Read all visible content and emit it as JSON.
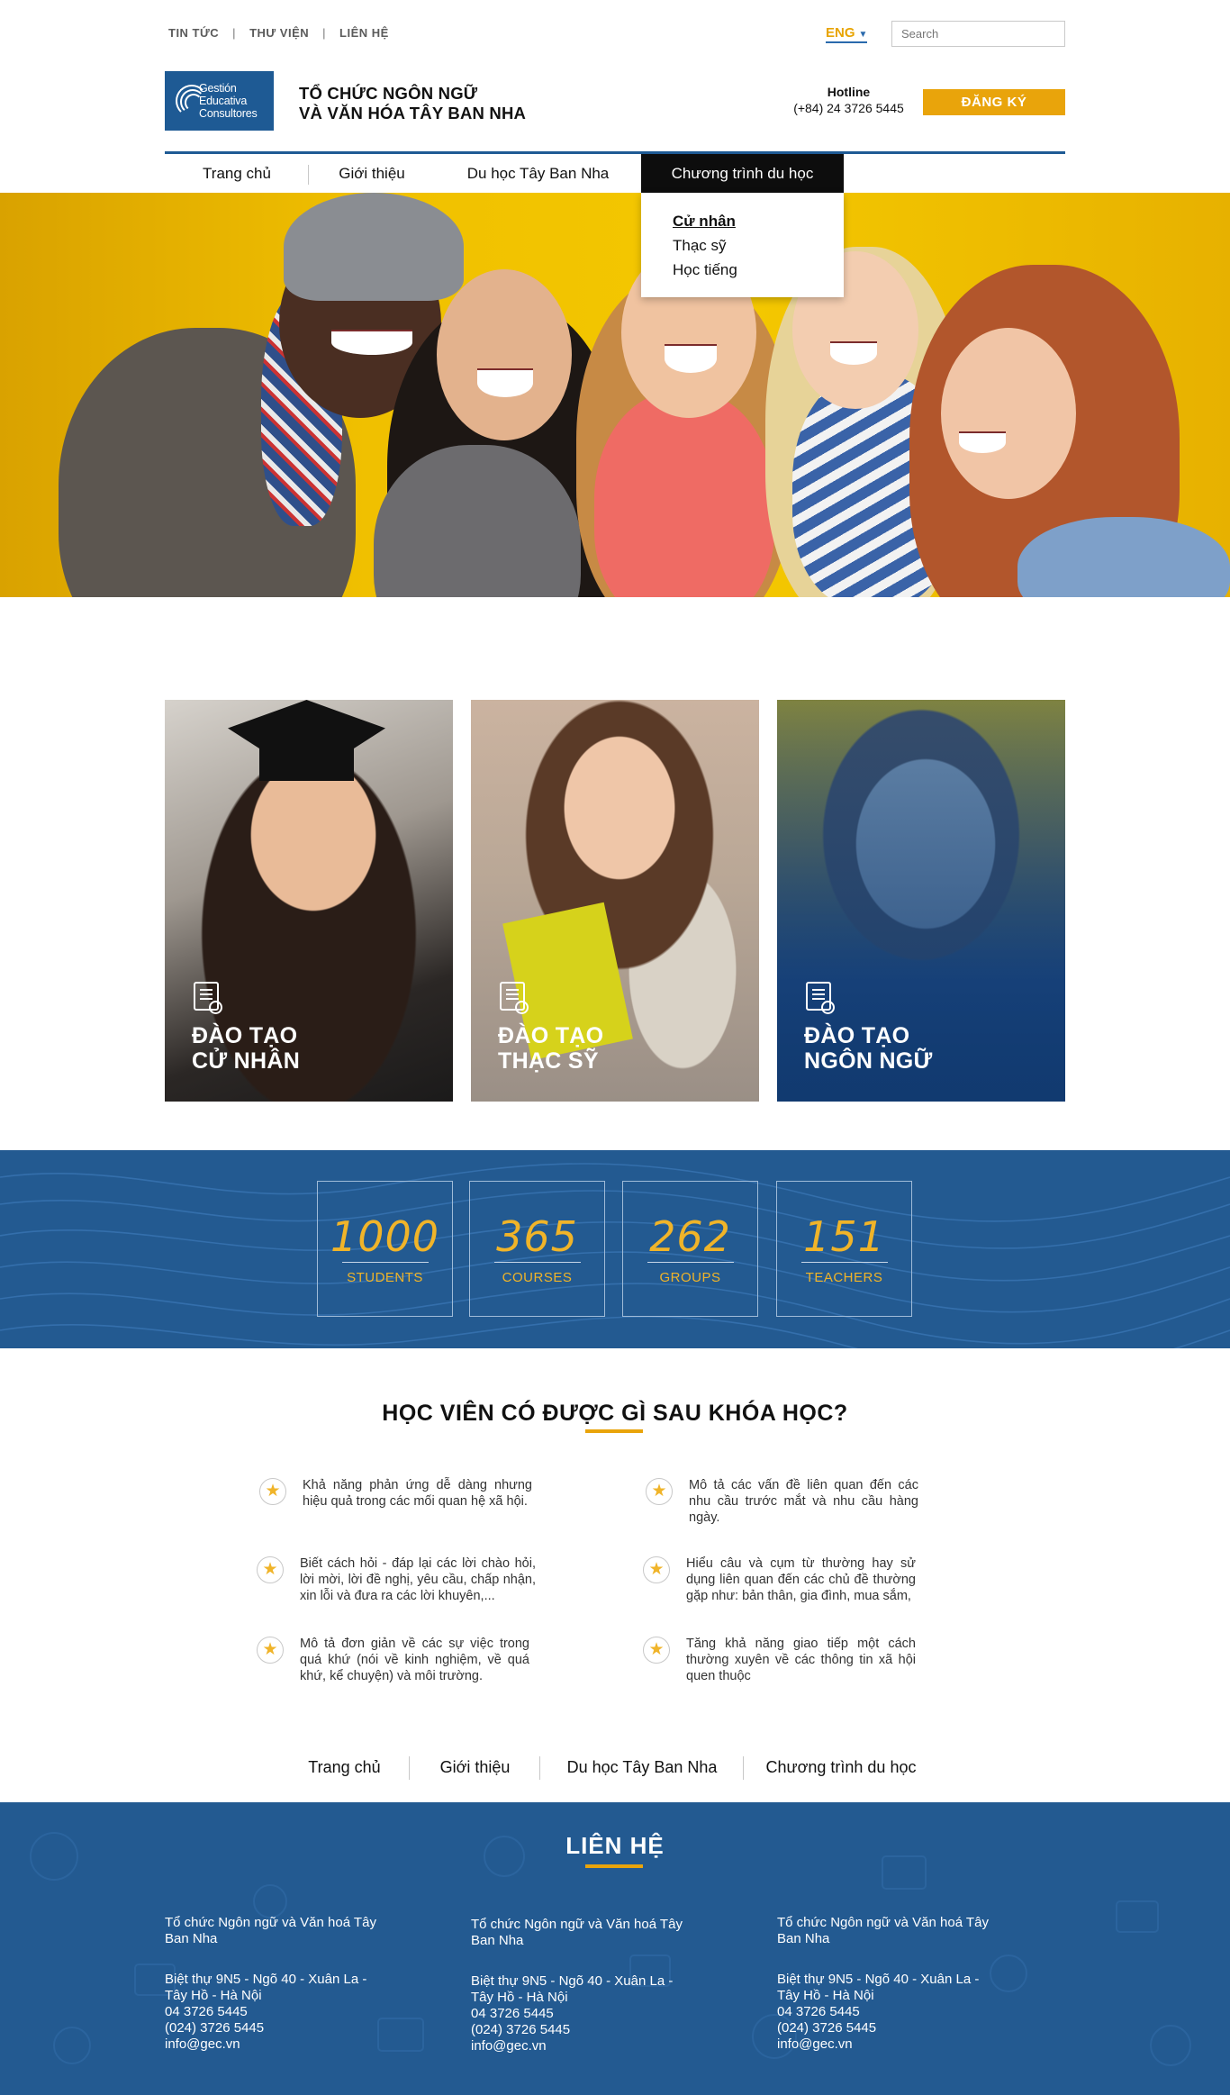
{
  "topbar": {
    "links": [
      "TIN TỨC",
      "THƯ VIỆN",
      "LIÊN HỆ"
    ],
    "separator": "|",
    "language": "ENG",
    "search_placeholder": "Search"
  },
  "header": {
    "logo_lines": [
      "Gestión",
      "Educativa",
      "Consultores"
    ],
    "org_line1": "TỔ CHỨC NGÔN NGỮ",
    "org_line2": "VÀ VĂN HÓA TÂY BAN NHA",
    "hotline_label": "Hotline",
    "hotline_number": "(+84) 24 3726 5445",
    "register_label": "ĐĂNG KÝ"
  },
  "nav": {
    "items": [
      "Trang chủ",
      "Giới thiệu",
      "Du học Tây Ban Nha",
      "Chương trình du học"
    ],
    "active_index": 3,
    "dropdown": [
      "Cử nhân",
      "Thạc sỹ",
      "Học tiếng"
    ],
    "dropdown_selected": 0
  },
  "cards": [
    {
      "line1": "ĐÀO TẠO",
      "line2": "CỬ NHÂN"
    },
    {
      "line1": "ĐÀO TẠO",
      "line2": "THẠC SỸ"
    },
    {
      "line1": "ĐÀO TẠO",
      "line2": "NGÔN NGỮ"
    }
  ],
  "stats": [
    {
      "value": "1000",
      "label": "STUDENTS"
    },
    {
      "value": "365",
      "label": "COURSES"
    },
    {
      "value": "262",
      "label": "GROUPS"
    },
    {
      "value": "151",
      "label": "TEACHERS"
    }
  ],
  "benefits": {
    "heading": "HỌC VIÊN CÓ ĐƯỢC GÌ SAU KHÓA HỌC?",
    "items": [
      "Khả năng phản ứng dễ dàng nhưng hiệu quả trong các mối quan hệ xã hội.",
      "Mô tả các vấn đề liên quan đến các nhu cầu trước mắt và nhu cầu hàng ngày.",
      "Biết cách hỏi - đáp lại các lời chào hỏi, lời mời, lời đề nghị, yêu cầu, chấp nhận, xin lỗi và đưa ra các lời khuyên,...",
      "Hiểu câu và cụm từ thường hay sử dụng liên quan đến các chủ đề thường gặp như: bản thân, gia đình, mua sắm,",
      "Mô tả đơn giản về các sự việc trong quá khứ (nói về kinh nghiệm, về quá khứ, kể chuyện) và môi trường.",
      "Tăng khả năng giao tiếp một cách thường xuyên về các thông tin xã hội quen thuộc"
    ]
  },
  "footer_nav": [
    "Trang chủ",
    "Giới thiệu",
    "Du học Tây Ban Nha",
    "Chương trình du học"
  ],
  "contact": {
    "title": "LIÊN HỆ",
    "columns": [
      {
        "org": [
          "Tổ chức Ngôn ngữ và Văn hoá Tây",
          "Ban Nha"
        ],
        "address": [
          "Biệt thự 9N5 - Ngõ 40 - Xuân La -",
          "Tây Hồ - Hà Nội"
        ],
        "phone1": "04 3726 5445",
        "phone2": "(024) 3726 5445",
        "email": "info@gec.vn"
      },
      {
        "org": [
          "Tổ chức Ngôn ngữ và Văn hoá Tây",
          "Ban Nha"
        ],
        "address": [
          "Biệt thự 9N5 - Ngõ 40 - Xuân La -",
          "Tây Hồ - Hà Nội"
        ],
        "phone1": "04 3726 5445",
        "phone2": "(024) 3726 5445",
        "email": "info@gec.vn"
      },
      {
        "org": [
          "Tổ chức Ngôn ngữ và Văn hoá Tây",
          "Ban Nha"
        ],
        "address": [
          "Biệt thự 9N5 - Ngõ 40 - Xuân La -",
          "Tây Hồ - Hà Nội"
        ],
        "phone1": "04 3726 5445",
        "phone2": "(024) 3726 5445",
        "email": "info@gec.vn"
      }
    ]
  },
  "colors": {
    "primary_blue": "#235a91",
    "accent_gold": "#e9a40b",
    "stat_gold": "#f0b429",
    "hero_yellow": "#f0c000"
  },
  "icons": [
    "chevron-down-icon",
    "diploma-icon",
    "star-icon"
  ]
}
